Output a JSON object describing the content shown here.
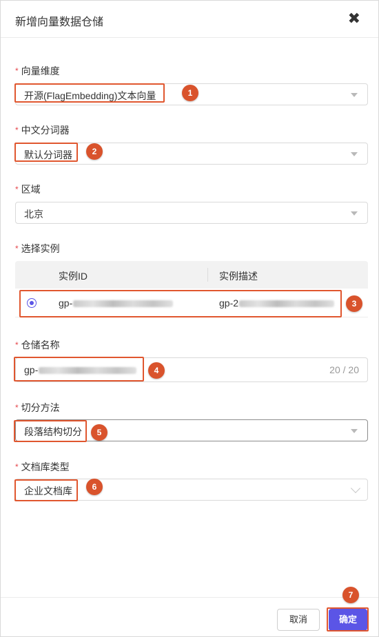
{
  "dialog": {
    "title": "新增向量数据仓储",
    "close_glyph": "✖"
  },
  "form": {
    "required_mark": "*",
    "vector_dim": {
      "label": "向量维度",
      "value": "开源(FlagEmbedding)文本向量"
    },
    "tokenizer": {
      "label": "中文分词器",
      "value": "默认分词器"
    },
    "region": {
      "label": "区域",
      "value": "北京"
    },
    "instance": {
      "label": "选择实例",
      "columns": [
        "实例ID",
        "实例描述"
      ],
      "rows": [
        {
          "id": "gp-",
          "desc": "gp-2",
          "selected": true
        }
      ]
    },
    "repo_name": {
      "label": "仓储名称",
      "value": "gp-",
      "count": "20 / 20"
    },
    "split_method": {
      "label": "切分方法",
      "value": "段落结构切分"
    },
    "doc_type": {
      "label": "文档库类型",
      "value": "企业文档库"
    }
  },
  "annotations": [
    "1",
    "2",
    "3",
    "4",
    "5",
    "6",
    "7"
  ],
  "footer": {
    "cancel_label": "取消",
    "ok_label": "确定"
  },
  "colors": {
    "accent": "#5b55e6",
    "highlight": "#e0562e",
    "badge": "#d9532c",
    "required": "#e5484d"
  },
  "icons": {
    "close": "close-icon",
    "select_caret": "caret-down-icon",
    "select_chevron": "chevron-down-icon"
  }
}
